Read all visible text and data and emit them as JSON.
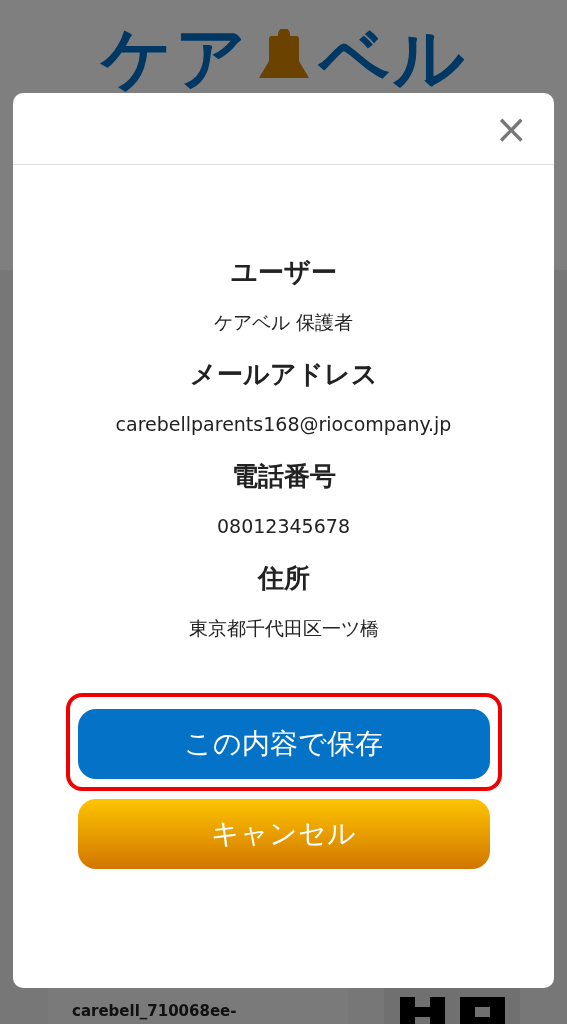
{
  "background_page": {
    "logo": {
      "left": "ケア",
      "right": "ベル"
    },
    "card_text": [
      "carebell_710068ee-"
    ]
  },
  "dialog": {
    "close": "×",
    "fields": [
      {
        "label": "ユーザー",
        "value": "ケアベル 保護者"
      },
      {
        "label": "メールアドレス",
        "value": "carebellparents168@riocompany.jp"
      },
      {
        "label": "電話番号",
        "value": "08012345678"
      },
      {
        "label": "住所",
        "value": "東京都千代田区一ツ橋"
      }
    ],
    "buttons": [
      {
        "kind": "primary",
        "label": "この内容で保存",
        "highlighted": true
      },
      {
        "kind": "secondary",
        "label": "キャンセル",
        "highlighted": false
      }
    ]
  }
}
